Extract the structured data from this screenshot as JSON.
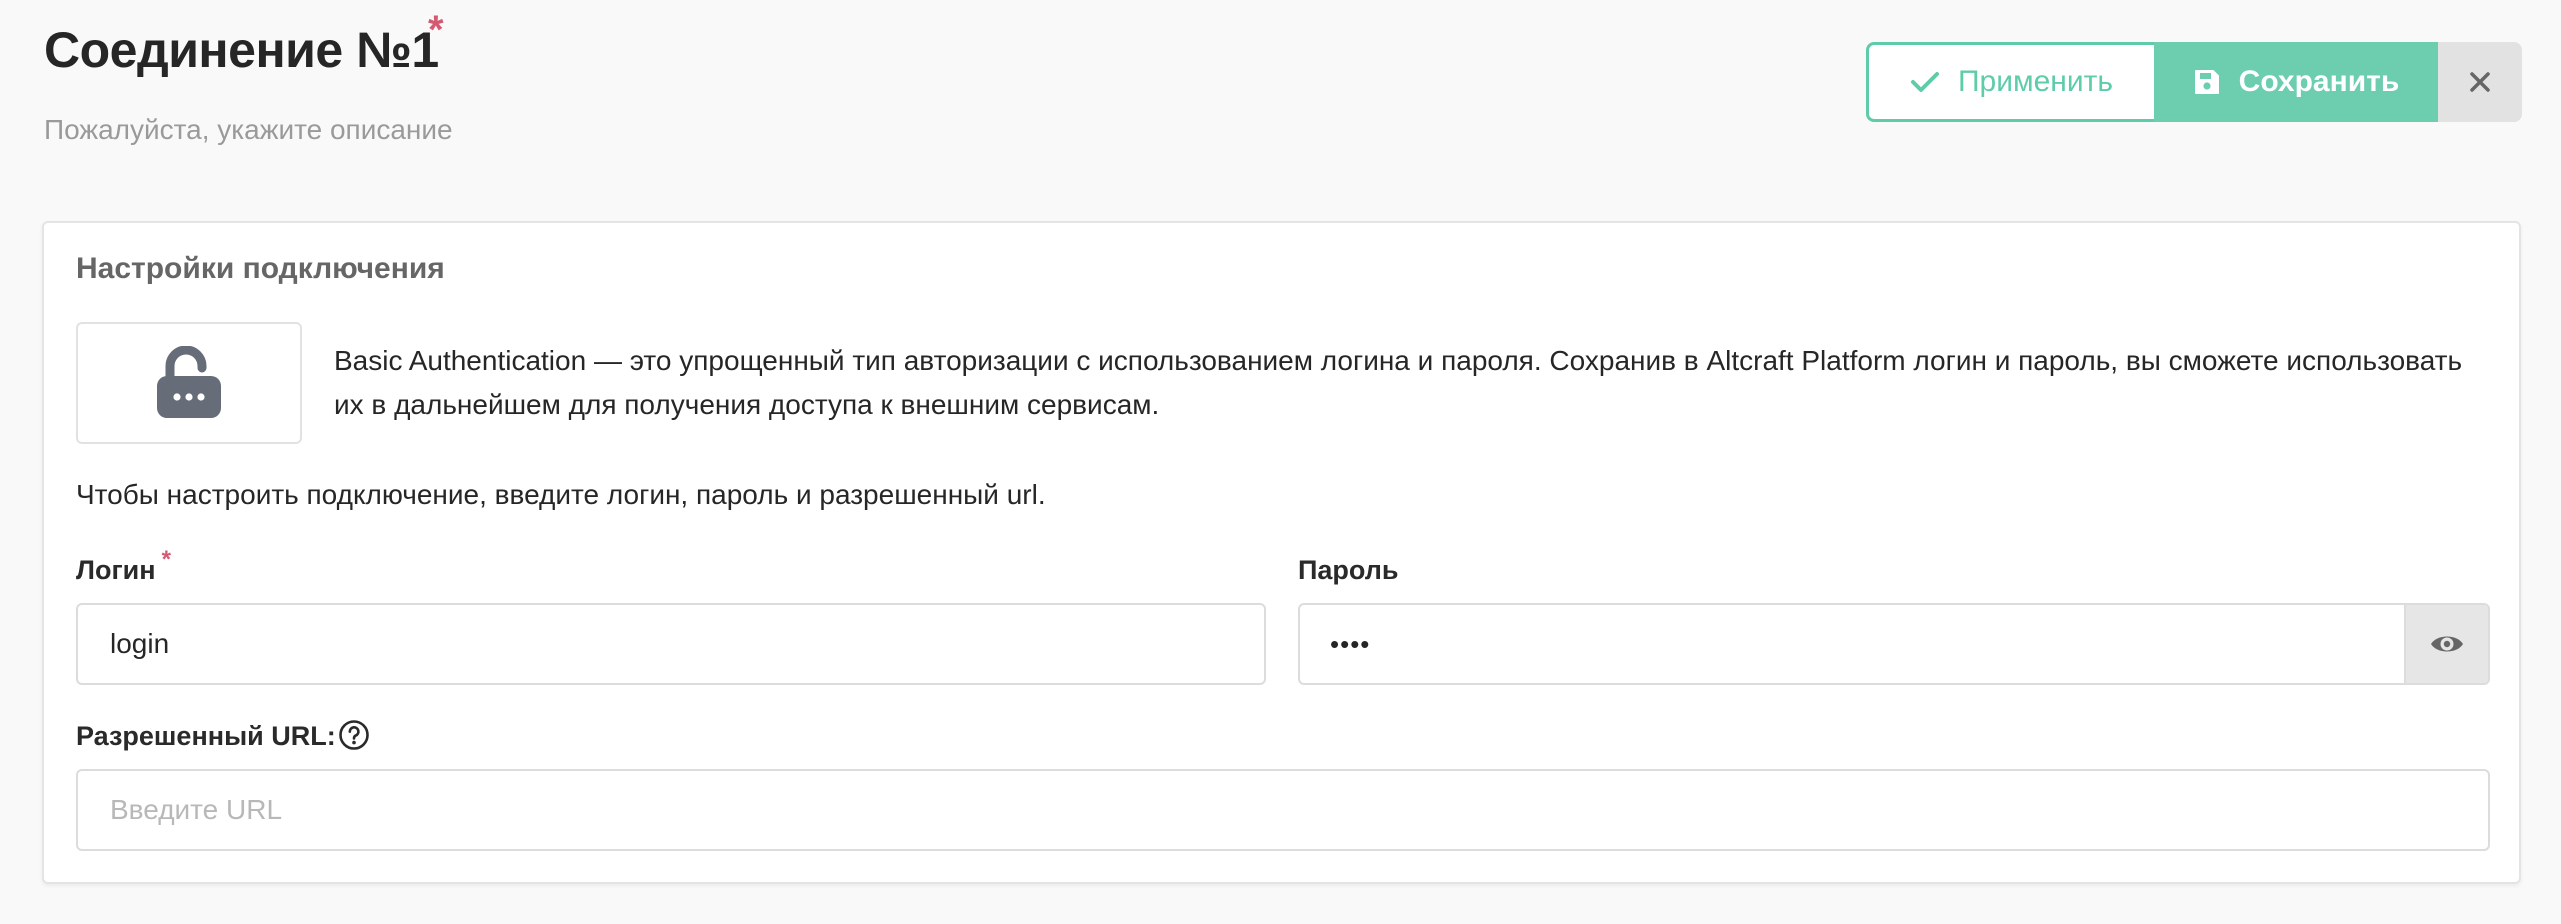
{
  "header": {
    "title": "Соединение №1",
    "required_mark": "*",
    "subtitle": "Пожалуйста, укажите описание",
    "apply_label": "Применить",
    "save_label": "Сохранить"
  },
  "card": {
    "title": "Настройки подключения",
    "description": "Basic Authentication — это упрощенный тип авторизации с использованием логина и пароля. Сохранив в Altcraft Platform логин и пароль, вы сможете использовать их в дальнейшем для получения доступа к внешним сервисам.",
    "hint": "Чтобы настроить подключение, введите логин, пароль и разрешенный url.",
    "login": {
      "label": "Логин",
      "required_mark": "*",
      "value": "login"
    },
    "password": {
      "label": "Пароль",
      "value": "••••"
    },
    "url": {
      "label": "Разрешенный URL:",
      "placeholder": "Введите URL",
      "value": ""
    }
  },
  "icons": {
    "apply": "check-icon",
    "save": "floppy-disk-icon",
    "close": "close-icon",
    "lock": "unlocked-padlock-icon",
    "password_toggle": "eye-icon",
    "help": "question-circle-icon"
  },
  "colors": {
    "accent": "#6dcdaf",
    "accent_border": "#5fcca9",
    "required": "#d45a72",
    "icon_gray": "#666d78"
  }
}
